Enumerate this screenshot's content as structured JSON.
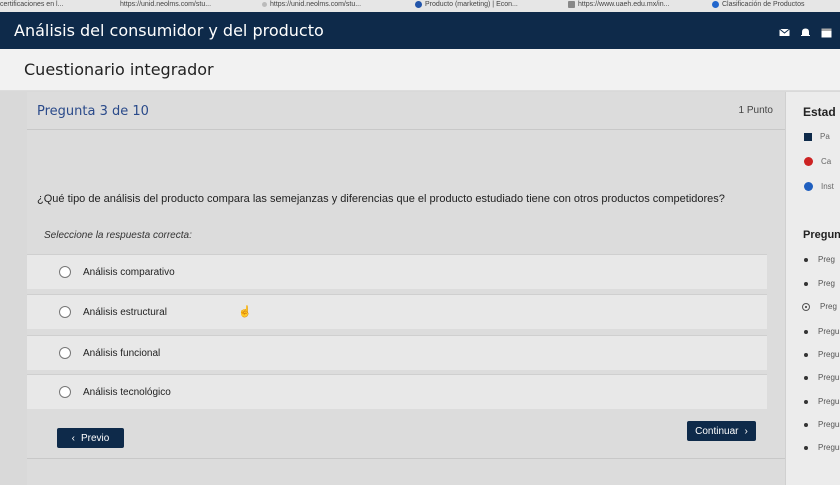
{
  "bookmarks": [
    {
      "label": "certificaciones en l...",
      "icon": "page-icon",
      "color": "#999999"
    },
    {
      "label": "https://unid.neolms.com/stu...",
      "icon": "page-icon",
      "color": "#999999"
    },
    {
      "label": "https://unid.neolms.com/stu...",
      "icon": "page-icon",
      "color": "#999999"
    },
    {
      "label": "Producto (marketing) | Econ...",
      "icon": "e-icon",
      "color": "#2255aa"
    },
    {
      "label": "https://www.uaeh.edu.mx/in...",
      "icon": "image-icon",
      "color": "#888888"
    },
    {
      "label": "Clasificación de Productos",
      "icon": "q-icon",
      "color": "#2266cc"
    }
  ],
  "header": {
    "title": "Análisis del consumidor y del producto"
  },
  "subheader": {
    "title": "Cuestionario integrador"
  },
  "question": {
    "counter": "Pregunta 3 de 10",
    "points": "1 Punto",
    "text": "¿Qué tipo de análisis del producto compara las semejanzas y diferencias que el producto estudiado tiene con otros productos competidores?",
    "instruction": "Seleccione la respuesta correcta:",
    "options": [
      "Análisis comparativo",
      "Análisis estructural",
      "Análisis funcional",
      "Análisis tecnológico"
    ]
  },
  "nav": {
    "prev_label": "Previo",
    "next_label": "Continuar"
  },
  "sidebar": {
    "status_title": "Estad",
    "statuses": [
      {
        "label": "Pa",
        "color": "#0e2a4a"
      },
      {
        "label": "Ca",
        "color": "#cc2222"
      },
      {
        "label": "Inst",
        "color": "#1f5fbf"
      }
    ],
    "questions_title": "Pregun",
    "questions": [
      "Preg",
      "Preg",
      "Preg",
      "Pregu",
      "Pregu",
      "Pregu",
      "Pregu",
      "Pregur",
      "Pregur"
    ]
  },
  "colors": {
    "header_bg": "#0e2a4a",
    "accent": "#2a4a8a"
  }
}
